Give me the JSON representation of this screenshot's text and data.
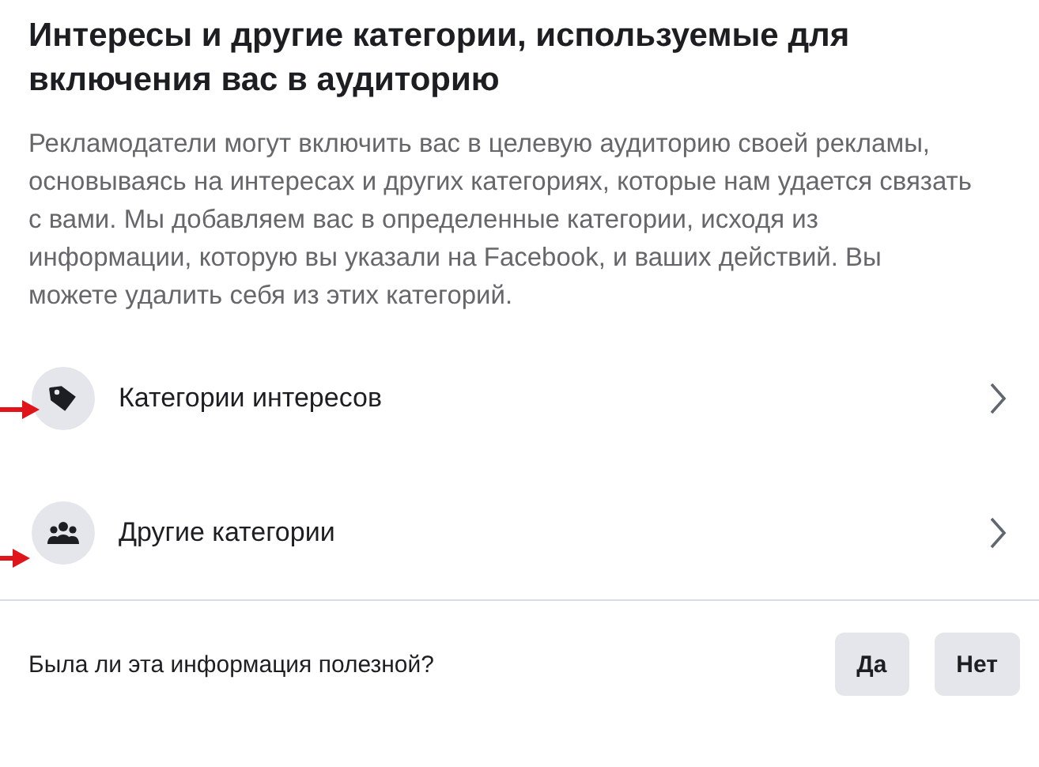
{
  "title": "Интересы и другие категории, используемые для включения вас в аудиторию",
  "description": "Рекламодатели могут включить вас в целевую аудиторию своей рекламы, основываясь на интересах и других категориях, которые нам удается связать с вами. Мы добавляем вас в определенные категории, исходя из информации, которую вы указали на Facebook, и ваших действий. Вы можете удалить себя из этих категорий.",
  "items": [
    {
      "kind": "tag",
      "label": "Категории интересов"
    },
    {
      "kind": "people",
      "label": "Другие категории"
    }
  ],
  "feedback": {
    "question": "Была ли эта информация полезной?",
    "buttons": [
      "Да",
      "Нет"
    ]
  }
}
